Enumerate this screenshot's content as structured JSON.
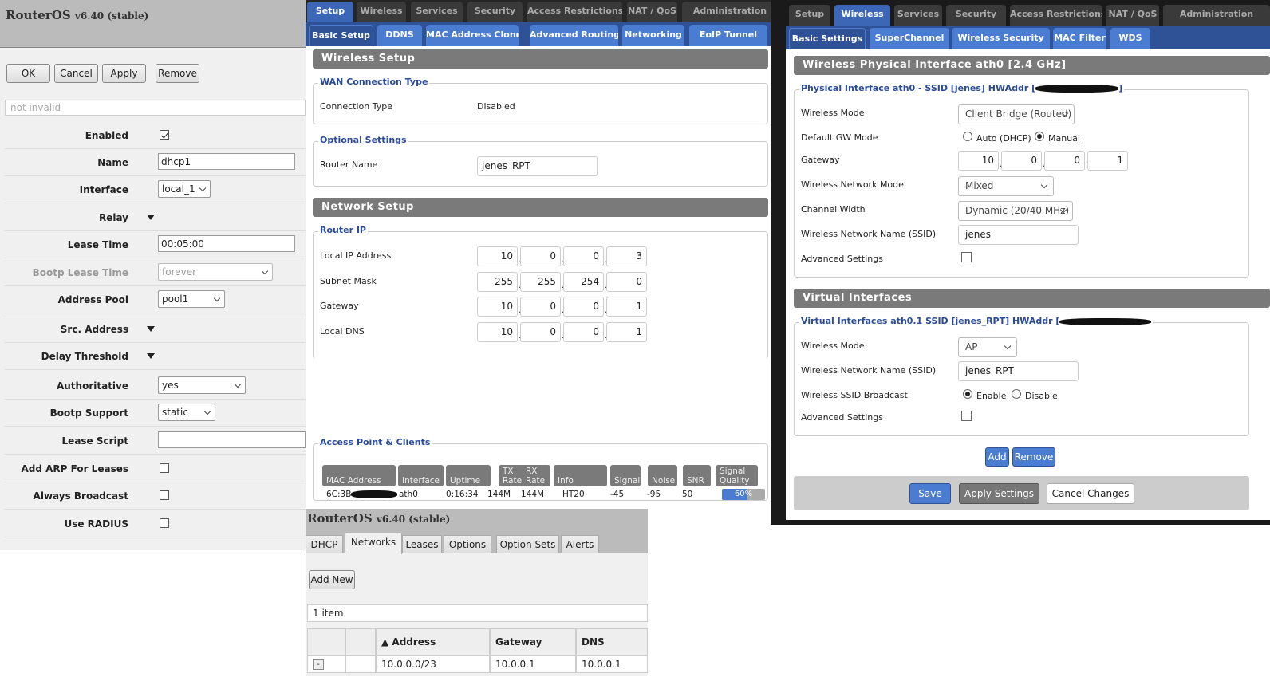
{
  "left": {
    "title": "RouterOS",
    "version": "v6.40 (stable)",
    "buttons": [
      "OK",
      "Cancel",
      "Apply",
      "Remove"
    ],
    "status": "not invalid",
    "rows": [
      {
        "label": "Enabled",
        "type": "check",
        "checked": true
      },
      {
        "label": "Name",
        "type": "input",
        "value": "dhcp1"
      },
      {
        "label": "Interface",
        "type": "select",
        "value": "local_1"
      },
      {
        "label": "Relay",
        "type": "expand"
      },
      {
        "label": "Lease Time",
        "type": "input",
        "value": "00:05:00"
      },
      {
        "label": "Bootp Lease Time",
        "type": "select",
        "value": "forever",
        "disabled": true
      },
      {
        "label": "Address Pool",
        "type": "select",
        "value": "pool1"
      },
      {
        "label": "Src. Address",
        "type": "expand"
      },
      {
        "label": "Delay Threshold",
        "type": "expand"
      },
      {
        "label": "Authoritative",
        "type": "select",
        "value": "yes"
      },
      {
        "label": "Bootp Support",
        "type": "select",
        "value": "static"
      },
      {
        "label": "Lease Script",
        "type": "input",
        "value": ""
      },
      {
        "label": "Add ARP For Leases",
        "type": "check",
        "checked": false
      },
      {
        "label": "Always Broadcast",
        "type": "check",
        "checked": false
      },
      {
        "label": "Use RADIUS",
        "type": "check",
        "checked": false
      }
    ]
  },
  "mid": {
    "tabs": [
      "Setup",
      "Wireless",
      "Services",
      "Security",
      "Access Restrictions",
      "NAT / QoS",
      "Administration"
    ],
    "subtabs": [
      "Basic Setup",
      "DDNS",
      "MAC Address Clone",
      "Advanced Routing",
      "Networking",
      "EoIP Tunnel"
    ],
    "wireless_setup": "Wireless Setup",
    "wan_legend": "WAN Connection Type",
    "conn_label": "Connection Type",
    "conn_value": "Disabled",
    "opt_legend": "Optional Settings",
    "router_name_label": "Router Name",
    "router_name": "jenes_RPT",
    "network_setup": "Network Setup",
    "router_ip_legend": "Router IP",
    "ip_rows": [
      {
        "label": "Local IP Address",
        "octets": [
          "10",
          "0",
          "0",
          "3"
        ]
      },
      {
        "label": "Subnet Mask",
        "octets": [
          "255",
          "255",
          "254",
          "0"
        ]
      },
      {
        "label": "Gateway",
        "octets": [
          "10",
          "0",
          "0",
          "1"
        ]
      },
      {
        "label": "Local DNS",
        "octets": [
          "10",
          "0",
          "0",
          "1"
        ]
      }
    ],
    "ap_legend": "Access Point & Clients",
    "ap_headers": [
      "MAC Address",
      "Interface",
      "Uptime",
      "TX Rate",
      "RX Rate",
      "Info",
      "Signal",
      "Noise",
      "SNR",
      "Signal Quality"
    ],
    "ap_row": [
      "6C:3B",
      "ath0",
      "0:16:34",
      "144M",
      "144M",
      "HT20",
      "-45",
      "-95",
      "50"
    ],
    "signal_quality": "60%",
    "signal_quality_value": 60
  },
  "bot": {
    "title": "RouterOS",
    "version": "v6.40 (stable)",
    "tabs": [
      "DHCP",
      "Networks",
      "Leases",
      "Options",
      "Option Sets",
      "Alerts"
    ],
    "add_new": "Add New",
    "count": "1 item",
    "headers": [
      "",
      "",
      "▲ Address",
      "Gateway",
      "DNS Servers"
    ],
    "row": {
      "btn": "-",
      "address": "10.0.0.0/23",
      "gateway": "10.0.0.1",
      "dns": "10.0.0.1"
    }
  },
  "right": {
    "tabs": [
      "Setup",
      "Wireless",
      "Services",
      "Security",
      "Access Restrictions",
      "NAT / QoS",
      "Administration"
    ],
    "subtabs": [
      "Basic Settings",
      "SuperChannel",
      "Wireless Security",
      "MAC Filter",
      "WDS"
    ],
    "phys_header": "Wireless Physical Interface ath0 [2.4 GHz]",
    "phys_legend": "Physical Interface ath0 - SSID [jenes] HWAddr [",
    "phys_legend_end": "]",
    "wireless_mode_label": "Wireless Mode",
    "wireless_mode": "Client Bridge (Routed)",
    "gw_mode_label": "Default GW Mode",
    "gw_auto": "Auto (DHCP)",
    "gw_manual": "Manual",
    "gateway_label": "Gateway",
    "gateway": [
      "10",
      "0",
      "0",
      "1"
    ],
    "net_mode_label": "Wireless Network Mode",
    "net_mode": "Mixed",
    "chan_label": "Channel Width",
    "chan": "Dynamic (20/40 MHz)",
    "ssid_label": "Wireless Network Name (SSID)",
    "ssid": "jenes",
    "adv_label": "Advanced Settings",
    "virt_header": "Virtual Interfaces",
    "virt_legend": "Virtual Interfaces ath0.1 SSID [jenes_RPT] HWAddr [",
    "v_mode_label": "Wireless Mode",
    "v_mode": "AP",
    "v_ssid_label": "Wireless Network Name (SSID)",
    "v_ssid": "jenes_RPT",
    "v_bcast_label": "Wireless SSID Broadcast",
    "v_enable": "Enable",
    "v_disable": "Disable",
    "v_adv_label": "Advanced Settings",
    "add": "Add",
    "remove": "Remove",
    "save": "Save",
    "apply": "Apply Settings",
    "cancel": "Cancel Changes"
  }
}
